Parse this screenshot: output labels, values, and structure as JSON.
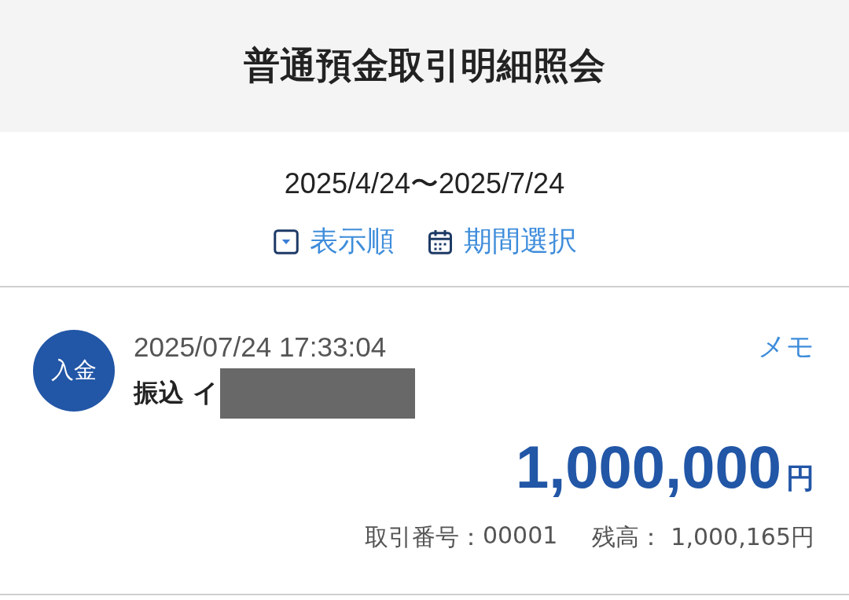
{
  "header": {
    "title": "普通預金取引明細照会"
  },
  "period": {
    "range": "2025/4/24〜2025/7/24",
    "actions": [
      {
        "kind": "sort",
        "label": "表示順"
      },
      {
        "kind": "calendar",
        "label": "期間選択"
      }
    ]
  },
  "transactions": [
    {
      "type_label": "入金",
      "datetime": "2025/07/24 17:33:04",
      "memo": "メモ",
      "description": "振込 イ",
      "redacted": true,
      "amount": "1,000,000",
      "currency": "円",
      "number_label": "取引番号：",
      "number": "00001",
      "balance_label": "残高：",
      "balance": "1,000,165円"
    }
  ]
}
